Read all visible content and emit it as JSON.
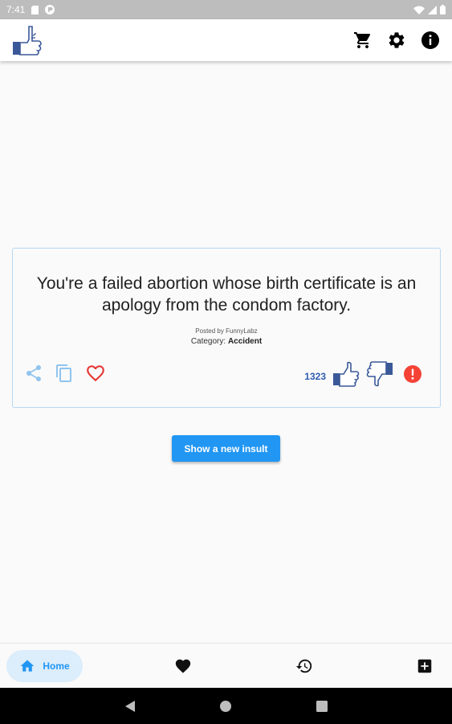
{
  "status_bar": {
    "time": "7:41"
  },
  "app_bar": {
    "logo_icon": "thumbs-up-logo-icon",
    "actions": [
      "cart-icon",
      "settings-gear-icon",
      "info-icon"
    ]
  },
  "insult": {
    "text": "You're a failed abortion whose birth certificate is an apology from the condom factory.",
    "posted_by": "Posted by FunnyLabz",
    "category_label": "Category:",
    "category_value": "Accident",
    "votes": "1323"
  },
  "actions": {
    "new_insult_label": "Show a new insult"
  },
  "bottom_nav": {
    "home_label": "Home"
  },
  "colors": {
    "accent": "#2196f3",
    "card_border": "#b9d7f3",
    "heart": "#e53935",
    "report": "#f44336",
    "thumb": "#3b5998"
  }
}
